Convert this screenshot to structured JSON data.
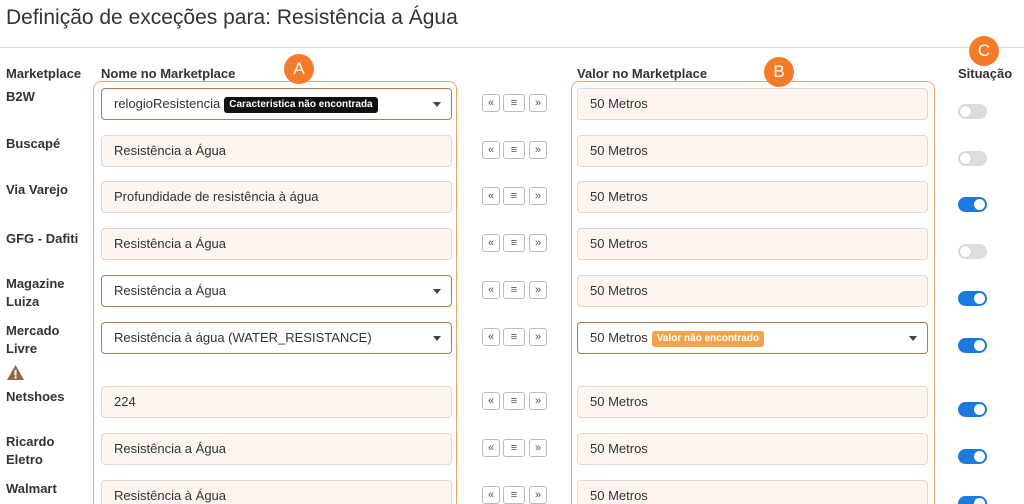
{
  "page_title": "Definição de exceções para: Resistência a Água",
  "headers": {
    "marketplace": "Marketplace",
    "name": "Nome no Marketplace",
    "value": "Valor no Marketplace",
    "status": "Situação"
  },
  "callouts": {
    "a": "A",
    "b": "B",
    "c": "C"
  },
  "rows": [
    {
      "marketplace": "B2W",
      "name": "relogioResistencia",
      "name_tag": "Caracteristica não encontrada",
      "name_select": true,
      "value": "50 Metros",
      "value_tag": "",
      "value_select": false,
      "active": false,
      "warning": false
    },
    {
      "marketplace": "Buscapé",
      "name": "Resistência a Água",
      "name_tag": "",
      "name_select": false,
      "value": "50 Metros",
      "value_tag": "",
      "value_select": false,
      "active": false,
      "warning": false
    },
    {
      "marketplace": "Via Varejo",
      "name": "Profundidade de resistência à água",
      "name_tag": "",
      "name_select": false,
      "value": "50 Metros",
      "value_tag": "",
      "value_select": false,
      "active": true,
      "warning": false
    },
    {
      "marketplace": "GFG - Dafiti",
      "name": "Resistência a Água",
      "name_tag": "",
      "name_select": false,
      "value": "50 Metros",
      "value_tag": "",
      "value_select": false,
      "active": false,
      "warning": false
    },
    {
      "marketplace": "Magazine Luiza",
      "name": "Resistência a Água",
      "name_tag": "",
      "name_select": true,
      "value": "50 Metros",
      "value_tag": "",
      "value_select": false,
      "active": true,
      "warning": false
    },
    {
      "marketplace": "Mercado Livre",
      "name": "Resistência à água (WATER_RESISTANCE)",
      "name_tag": "",
      "name_select": true,
      "value": "50 Metros",
      "value_tag": "Valor não encontrado",
      "value_select": true,
      "active": true,
      "warning": true
    },
    {
      "marketplace": "Netshoes",
      "name": "224",
      "name_tag": "",
      "name_select": false,
      "value": "50 Metros",
      "value_tag": "",
      "value_select": false,
      "active": true,
      "warning": false
    },
    {
      "marketplace": "Ricardo Eletro",
      "name": "Resistência a Água",
      "name_tag": "",
      "name_select": false,
      "value": "50 Metros",
      "value_tag": "",
      "value_select": false,
      "active": true,
      "warning": false
    },
    {
      "marketplace": "Walmart",
      "name": "Resistência à Água",
      "name_tag": "",
      "name_select": false,
      "value": "50 Metros",
      "value_tag": "",
      "value_select": false,
      "active": true,
      "warning": false
    }
  ],
  "icons": {
    "left": "«",
    "center": "≡",
    "right": "»",
    "warning": "warning-triangle-icon"
  },
  "colors": {
    "accent": "#f47b2a",
    "toggle_on": "#1a7ae0",
    "toggle_off": "#dddddd",
    "tag_dark": "#111111",
    "tag_orange": "#f0a34b"
  }
}
